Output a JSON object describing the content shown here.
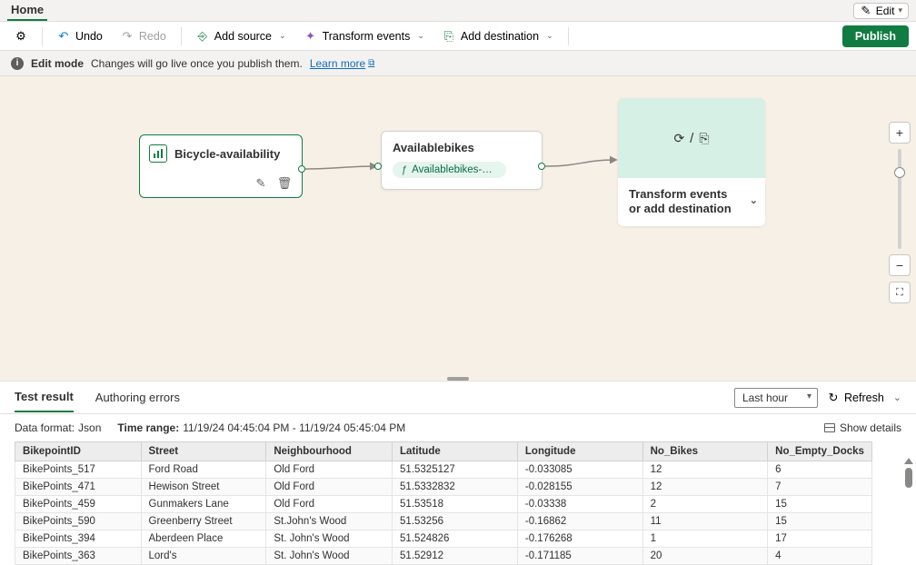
{
  "titlebar": {
    "tab": "Home",
    "edit": "Edit"
  },
  "toolbar": {
    "undo": "Undo",
    "redo": "Redo",
    "add_source": "Add source",
    "transform": "Transform events",
    "add_dest": "Add destination",
    "publish": "Publish"
  },
  "infobar": {
    "mode": "Edit mode",
    "msg": "Changes will go live once you publish them.",
    "learn": "Learn more"
  },
  "canvas": {
    "source": {
      "title": "Bicycle-availability"
    },
    "op": {
      "title": "Availablebikes",
      "pill": "Availablebikes-stre..."
    },
    "placeholder": {
      "text": "Transform events or add destination"
    }
  },
  "results": {
    "tabs": {
      "test": "Test result",
      "errors": "Authoring errors"
    },
    "dd": "Last hour",
    "refresh": "Refresh",
    "meta": {
      "df_lbl": "Data format:",
      "df_val": "Json",
      "tr_lbl": "Time range:",
      "tr_val": "11/19/24 04:45:04 PM - 11/19/24 05:45:04 PM",
      "show": "Show details"
    },
    "columns": [
      "BikepointID",
      "Street",
      "Neighbourhood",
      "Latitude",
      "Longitude",
      "No_Bikes",
      "No_Empty_Docks"
    ],
    "rows": [
      [
        "BikePoints_517",
        "Ford Road",
        "Old Ford",
        "51.5325127",
        "-0.033085",
        "12",
        "6"
      ],
      [
        "BikePoints_471",
        "Hewison Street",
        "Old Ford",
        "51.5332832",
        "-0.028155",
        "12",
        "7"
      ],
      [
        "BikePoints_459",
        "Gunmakers Lane",
        "Old Ford",
        "51.53518",
        "-0.03338",
        "2",
        "15"
      ],
      [
        "BikePoints_590",
        "Greenberry Street",
        "St.John's Wood",
        "51.53256",
        "-0.16862",
        "11",
        "15"
      ],
      [
        "BikePoints_394",
        "Aberdeen Place",
        "St. John's Wood",
        "51.524826",
        "-0.176268",
        "1",
        "17"
      ],
      [
        "BikePoints_363",
        "Lord's",
        "St. John's Wood",
        "51.52912",
        "-0.171185",
        "20",
        "4"
      ]
    ]
  }
}
